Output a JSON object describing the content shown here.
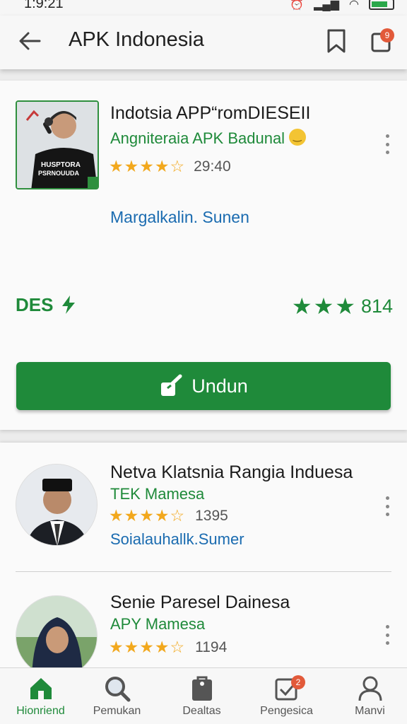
{
  "status_bar": {
    "time": "1:9:21"
  },
  "app_bar": {
    "title": "APK Indonesia",
    "notification_count": "9"
  },
  "featured": {
    "title": "Indotsia APP“romDIESEII",
    "subtitle": "Angniteraia APK Badunal",
    "rating_stars": "★★★★☆",
    "time": "29:40",
    "link": "Margalkalin. Sunen",
    "badge_label": "DES",
    "stars_display": "★★★",
    "stat_value": "814",
    "download_label": "Undun",
    "thumb_shirt_text": "HUSPTORA",
    "thumb_shirt_text2": "PSRNOUUDA"
  },
  "list_items": [
    {
      "title": "Netva Klatsnia Rangia Induesa",
      "subtitle": "TEK Mamesa",
      "rating_stars": "★★★★☆",
      "count": "1395",
      "link": "Soialauhallk.Sumer"
    },
    {
      "title": "Senie Paresel Dainesa",
      "subtitle": "APY Mamesa",
      "rating_stars": "★★★★☆",
      "count": "1194"
    }
  ],
  "bottom_nav": [
    {
      "label": "Hionriend",
      "icon": "home-icon"
    },
    {
      "label": "Pemukan",
      "icon": "search-icon"
    },
    {
      "label": "Dealtas",
      "icon": "bag-icon"
    },
    {
      "label": "Pengesica",
      "icon": "checklist-icon",
      "badge": "2"
    },
    {
      "label": "Manvi",
      "icon": "profile-icon"
    }
  ],
  "colors": {
    "accent": "#1f8a3a",
    "link": "#1a6bb0",
    "star": "#f2a81d",
    "badge": "#e25a3a"
  }
}
